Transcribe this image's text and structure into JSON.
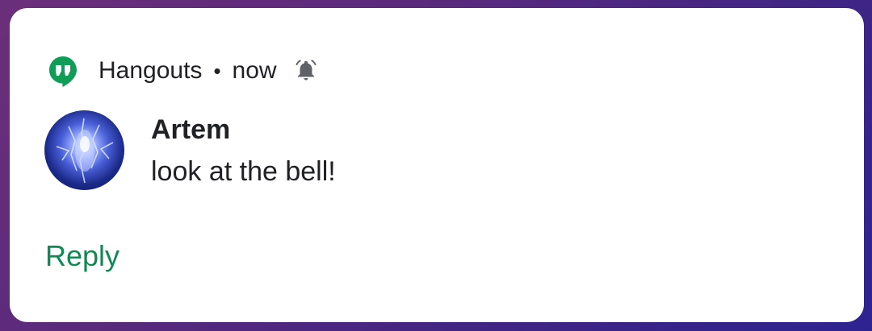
{
  "notification": {
    "app_name": "Hangouts",
    "separator": "•",
    "time": "now",
    "app_icon": "hangouts-icon",
    "alert_icon": "bell-icon",
    "sender": "Artem",
    "message": "look at the bell!",
    "action_label": "Reply"
  },
  "colors": {
    "brand_green": "#0f8a55",
    "hangouts_green": "#0f9d58",
    "text": "#202124",
    "card_background": "#ffffff"
  }
}
